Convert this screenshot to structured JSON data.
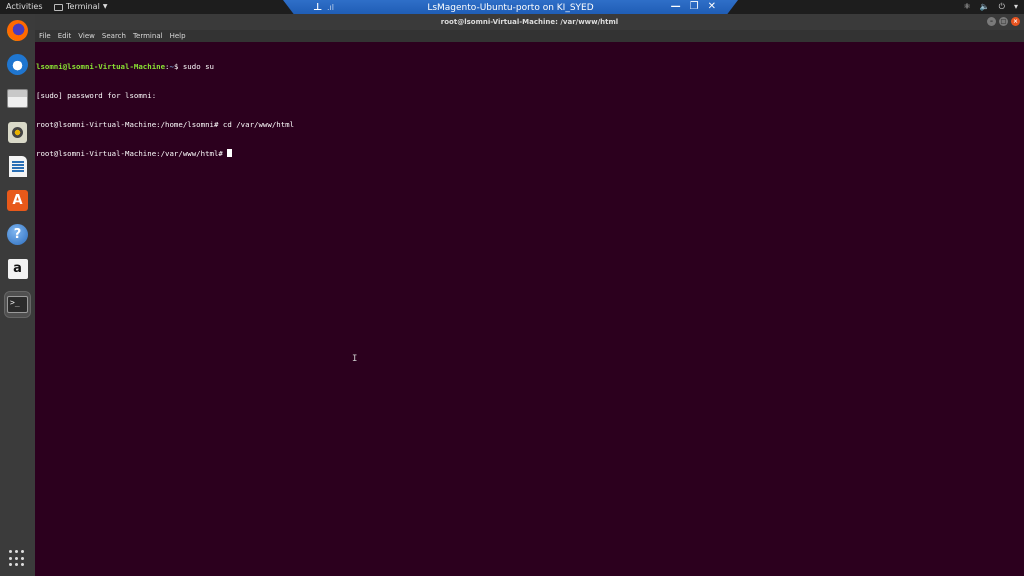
{
  "top_bar": {
    "activities": "Activities",
    "app_menu": "Terminal"
  },
  "remote_desktop": {
    "title": "LsMagento-Ubuntu-porto on KI_SYED"
  },
  "window": {
    "title": "root@lsomni-Virtual-Machine: /var/www/html"
  },
  "menu": [
    "File",
    "Edit",
    "View",
    "Search",
    "Terminal",
    "Help"
  ],
  "dock": {
    "items": [
      "firefox-icon",
      "thunderbird-icon",
      "files-icon",
      "rhythmbox-icon",
      "writer-icon",
      "software-icon",
      "help-icon",
      "amazon-icon",
      "terminal-icon"
    ],
    "active": "terminal-icon"
  },
  "terminal": {
    "line1_user": "lsomni@lsomni-Virtual-Machine",
    "line1_sep": ":",
    "line1_path": "~",
    "line1_cmd": "$ sudo su",
    "line2": "[sudo] password for lsomni:",
    "line3": "root@lsomni-Virtual-Machine:/home/lsomni# cd /var/www/html",
    "line4": "root@lsomni-Virtual-Machine:/var/www/html# "
  },
  "colors": {
    "terminal_bg": "#2c001e",
    "prompt_user": "#8ae234",
    "prompt_path": "#729fcf",
    "remote_bar": "#1b58b0",
    "close_button": "#e95420"
  }
}
